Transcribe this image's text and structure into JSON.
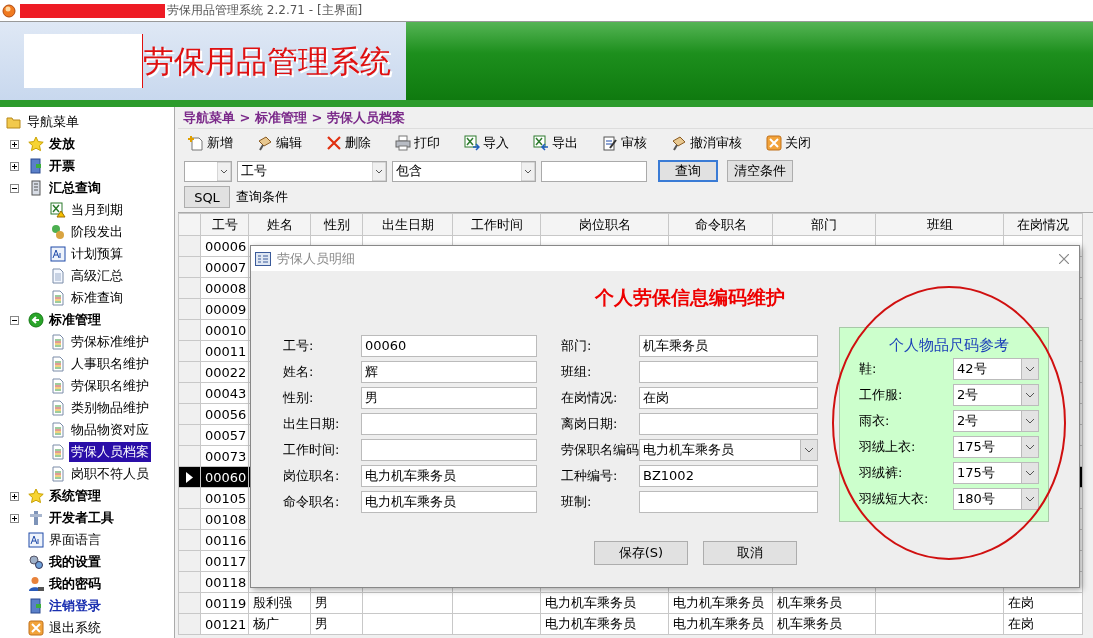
{
  "window": {
    "title": "劳保用品管理系统 2.2.71 - [主界面]"
  },
  "header": {
    "title": "劳保用品管理系统"
  },
  "sidebar": {
    "items": [
      {
        "label": "导航菜单",
        "kind": "normal",
        "selected": false,
        "children": [
          {
            "label": "发放",
            "kind": "bold",
            "selected": false,
            "expanded": false
          },
          {
            "label": "开票",
            "kind": "bold",
            "selected": false,
            "expanded": false
          },
          {
            "label": "汇总查询",
            "kind": "bold",
            "selected": false,
            "expanded": true,
            "children": [
              {
                "label": "当月到期",
                "kind": "normal",
                "selected": false
              },
              {
                "label": "阶段发出",
                "kind": "normal",
                "selected": false
              },
              {
                "label": "计划预算",
                "kind": "normal",
                "selected": false
              },
              {
                "label": "高级汇总",
                "kind": "normal",
                "selected": false
              },
              {
                "label": "标准查询",
                "kind": "normal",
                "selected": false
              }
            ]
          },
          {
            "label": "标准管理",
            "kind": "bold",
            "selected": false,
            "expanded": true,
            "children": [
              {
                "label": "劳保标准维护",
                "kind": "normal",
                "selected": false
              },
              {
                "label": "人事职名维护",
                "kind": "normal",
                "selected": false
              },
              {
                "label": "劳保职名维护",
                "kind": "normal",
                "selected": false
              },
              {
                "label": "类别物品维护",
                "kind": "normal",
                "selected": false
              },
              {
                "label": "物品物资对应",
                "kind": "normal",
                "selected": false
              },
              {
                "label": "劳保人员档案",
                "kind": "normal",
                "selected": true
              },
              {
                "label": "岗职不符人员",
                "kind": "normal",
                "selected": false
              }
            ]
          },
          {
            "label": "系统管理",
            "kind": "bold",
            "selected": false,
            "expanded": false
          },
          {
            "label": "开发者工具",
            "kind": "bold",
            "selected": false,
            "expanded": false
          },
          {
            "label": "界面语言",
            "kind": "normal",
            "selected": false
          },
          {
            "label": "我的设置",
            "kind": "bold",
            "selected": false
          },
          {
            "label": "我的密码",
            "kind": "bold",
            "selected": false
          },
          {
            "label": "注销登录",
            "kind": "link",
            "selected": false
          },
          {
            "label": "退出系统",
            "kind": "normal",
            "selected": false
          }
        ]
      }
    ]
  },
  "breadcrumb": "导航菜单 > 标准管理 > 劳保人员档案",
  "toolbar": [
    "新增",
    "编辑",
    "删除",
    "打印",
    "导入",
    "导出",
    "审核",
    "撤消审核",
    "关闭"
  ],
  "filter": {
    "field": "工号",
    "operator": "包含",
    "query_button": "查询",
    "clear_button": "清空条件",
    "sql_button": "SQL",
    "condition_label": "查询条件"
  },
  "table": {
    "columns": [
      "工号",
      "姓名",
      "性别",
      "出生日期",
      "工作时间",
      "岗位职名",
      "命令职名",
      "部门",
      "班组",
      "在岗情况"
    ],
    "rows": [
      {
        "id": "00006",
        "selected": false
      },
      {
        "id": "00007",
        "selected": false
      },
      {
        "id": "00008",
        "selected": false
      },
      {
        "id": "00009",
        "selected": false
      },
      {
        "id": "00010",
        "selected": false
      },
      {
        "id": "00011",
        "selected": false
      },
      {
        "id": "00022",
        "selected": false
      },
      {
        "id": "00043",
        "selected": false
      },
      {
        "id": "00056",
        "selected": false
      },
      {
        "id": "00057",
        "selected": false
      },
      {
        "id": "00073",
        "selected": false
      },
      {
        "id": "00060",
        "selected": true
      },
      {
        "id": "00105",
        "selected": false
      },
      {
        "id": "00108",
        "selected": false
      },
      {
        "id": "00116",
        "selected": false
      },
      {
        "id": "00117",
        "selected": false
      },
      {
        "id": "00118",
        "selected": false
      },
      {
        "id": "00119",
        "name": "殷利强",
        "sex": "男",
        "post_title": "电力机车乘务员",
        "order_title": "电力机车乘务员",
        "department": "机车乘务员",
        "status": "在岗",
        "selected": false
      },
      {
        "id": "00121",
        "name": "杨广",
        "sex": "男",
        "post_title": "电力机车乘务员",
        "order_title": "电力机车乘务员",
        "department": "机车乘务员",
        "status": "在岗",
        "selected": false
      }
    ]
  },
  "dialog": {
    "title": "劳保人员明细",
    "heading": "个人劳保信息编码维护",
    "left_fields": [
      {
        "label": "工号:",
        "value": "00060",
        "kind": "text"
      },
      {
        "label": "姓名:",
        "value": "辉",
        "kind": "text"
      },
      {
        "label": "性别:",
        "value": "男",
        "kind": "text"
      },
      {
        "label": "出生日期:",
        "kind": "text"
      },
      {
        "label": "工作时间:",
        "kind": "text"
      },
      {
        "label": "岗位职名:",
        "value": "电力机车乘务员",
        "kind": "text"
      },
      {
        "label": "命令职名:",
        "value": "电力机车乘务员",
        "kind": "text"
      }
    ],
    "right_fields": [
      {
        "label": "部门:",
        "value": "机车乘务员",
        "kind": "text"
      },
      {
        "label": "班组:",
        "kind": "text"
      },
      {
        "label": "在岗情况:",
        "value": "在岗",
        "kind": "text"
      },
      {
        "label": "离岗日期:",
        "kind": "text"
      },
      {
        "label": "劳保职名编码",
        "value": "电力机车乘务员",
        "kind": "combo"
      },
      {
        "label": "工种编号:",
        "value": "BZ1002",
        "kind": "text"
      },
      {
        "label": "班制:",
        "kind": "text"
      }
    ],
    "size_panel": {
      "title": "个人物品尺码参考",
      "items": [
        {
          "label": "鞋:",
          "value": "42号"
        },
        {
          "label": "工作服:",
          "value": "2号"
        },
        {
          "label": "雨衣:",
          "value": "2号"
        },
        {
          "label": "羽绒上衣:",
          "value": "175号"
        },
        {
          "label": "羽绒裤:",
          "value": "175号"
        },
        {
          "label": "羽绒短大衣:",
          "value": "180号"
        }
      ]
    },
    "buttons": [
      "保存(S)",
      "取消"
    ]
  }
}
